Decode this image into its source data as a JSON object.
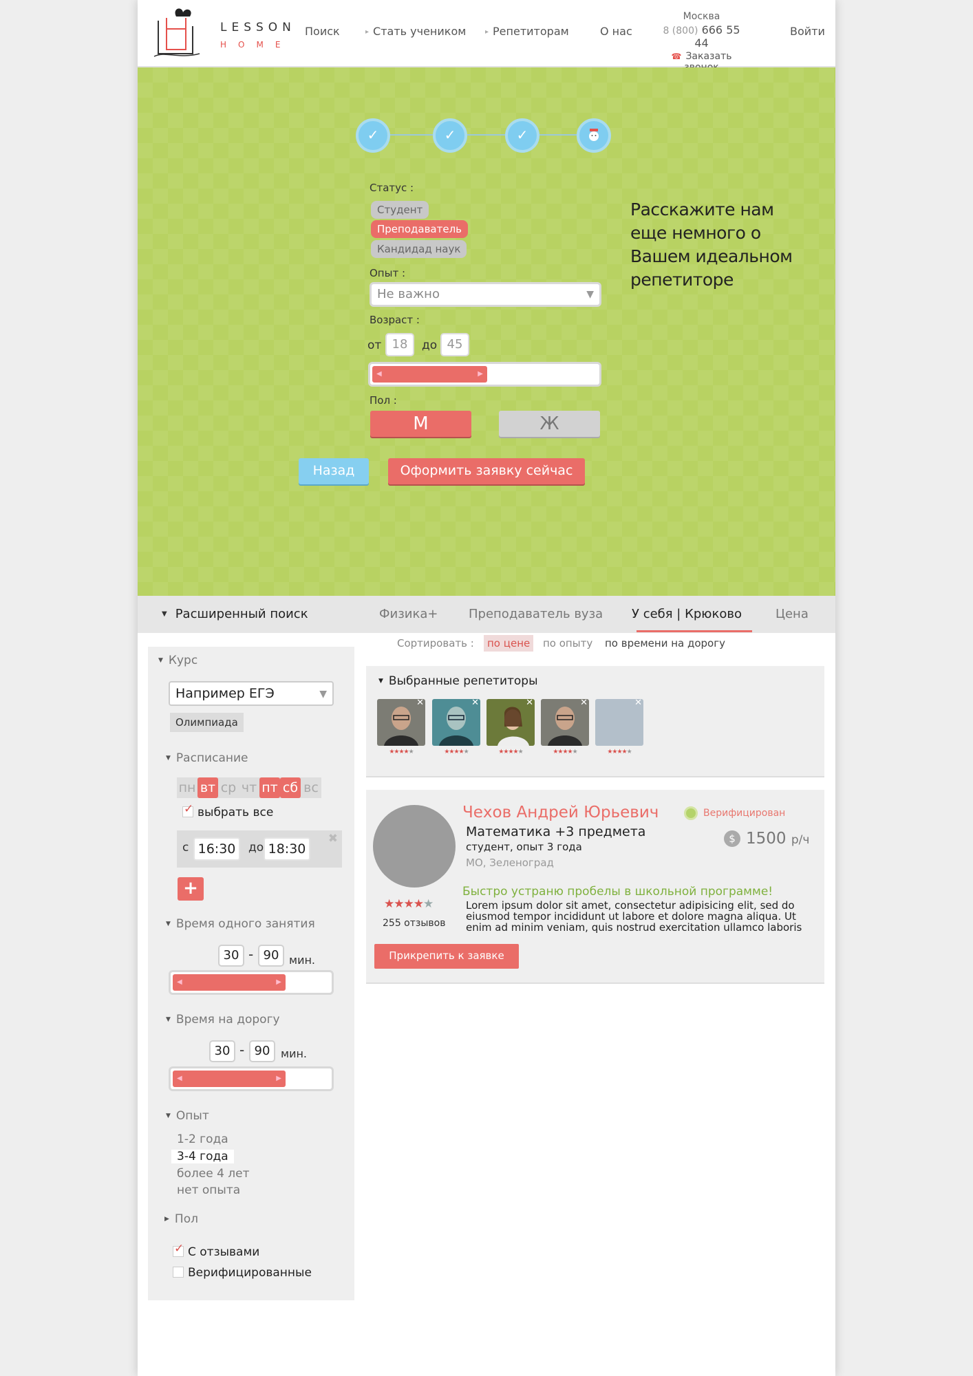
{
  "header": {
    "logo": {
      "word1": "LESSON",
      "word2": "HOME"
    },
    "nav": [
      {
        "label": "Поиск",
        "arrow": false
      },
      {
        "label": "Стать учеником",
        "arrow": true
      },
      {
        "label": "Репетиторам",
        "arrow": true
      },
      {
        "label": "О нас",
        "arrow": false
      }
    ],
    "contact": {
      "city": "Москва",
      "phone_prefix": "8 (800)",
      "phone": "666 55 44",
      "call_label": "Заказать звонок"
    },
    "login": "Войти"
  },
  "hero": {
    "steps": [
      {
        "state": "done",
        "icon": "check-icon"
      },
      {
        "state": "done",
        "icon": "check-icon"
      },
      {
        "state": "done",
        "icon": "check-icon"
      },
      {
        "state": "current",
        "icon": "student-avatar-icon"
      }
    ],
    "status_label": "Статус :",
    "status_options": [
      {
        "label": "Студент",
        "active": false
      },
      {
        "label": "Преподаватель",
        "active": true
      },
      {
        "label": "Кандидад наук",
        "active": false
      }
    ],
    "experience_label": "Опыт :",
    "experience_value": "Не важно",
    "age_label": "Возраст :",
    "age_from_label": "от",
    "age_from": "18",
    "age_to_label": "до",
    "age_to": "45",
    "age_range_fill": 0.5,
    "gender_label": "Пол :",
    "gender_m": "М",
    "gender_f": "Ж",
    "gender_selected": "М",
    "back_button": "Назад",
    "submit_button": "Оформить заявку сейчас",
    "side_text": "Расскажите нам еще немного о Вашем идеальном репетиторе"
  },
  "searchbar": {
    "title": "Расширенный поиск",
    "items": [
      {
        "label": "Физика+"
      },
      {
        "label": "Преподаватель вуза"
      },
      {
        "label": "У себя | Крюково",
        "active": true
      },
      {
        "label": "Цена"
      }
    ]
  },
  "sidebar": {
    "course_title": "Курс",
    "course_placeholder": "Например ЕГЭ",
    "course_tag": "Олимпиада",
    "schedule_title": "Расписание",
    "days": [
      {
        "label": "пн",
        "on": false
      },
      {
        "label": "вт",
        "on": true
      },
      {
        "label": "ср",
        "on": false
      },
      {
        "label": "чт",
        "on": false
      },
      {
        "label": "пт",
        "on": true
      },
      {
        "label": "сб",
        "on": true
      },
      {
        "label": "вс",
        "on": false
      }
    ],
    "select_all": "выбрать все",
    "time_from_label": "с",
    "time_from": "16:30",
    "time_to_label": "до",
    "time_to": "18:30",
    "add_label": "+",
    "lesson_time_title": "Время одного занятия",
    "lesson_min": "30",
    "lesson_max": "90",
    "lesson_unit": "мин.",
    "lesson_fill": 0.7,
    "road_time_title": "Время на дорогу",
    "road_min": "30",
    "road_max": "90",
    "road_unit": "мин.",
    "road_fill": 0.7,
    "experience_title": "Опыт",
    "experience_options": [
      {
        "label": "1-2 года",
        "selected": false
      },
      {
        "label": "3-4 года",
        "selected": true
      },
      {
        "label": "более 4 лет",
        "selected": false
      },
      {
        "label": "нет опыта",
        "selected": false
      }
    ],
    "gender_title": "Пол",
    "checks": [
      {
        "label": "С отзывами",
        "checked": true
      },
      {
        "label": "Верифицированные",
        "checked": false
      }
    ]
  },
  "sort": {
    "label": "Сортировать :",
    "options": [
      {
        "label": "по цене",
        "active": true
      },
      {
        "label": "по опыту",
        "active": false
      },
      {
        "label": "по времени на дорогу",
        "active": false
      }
    ]
  },
  "chosen": {
    "title": "Выбранные репетиторы",
    "tutors": [
      {
        "rating": 4,
        "photo": "man-glasses"
      },
      {
        "rating": 4,
        "photo": "man-glasses-teal"
      },
      {
        "rating": 4,
        "photo": "woman"
      },
      {
        "rating": 4,
        "photo": "man-glasses"
      },
      {
        "rating": 4,
        "photo": "empty"
      }
    ]
  },
  "card": {
    "name": "Чехов Андрей Юрьевич",
    "verified": "Верифицирован",
    "subjects": "Математика +3 предмета",
    "info": "студент, опыт 3 года",
    "location": "МО, Зеленоград",
    "price_value": "1500",
    "price_unit": "р/ч",
    "rating": 4,
    "reviews": "255 отзывов",
    "tagline": "Быстро устраню пробелы в школьной программе!",
    "description": "Lorem ipsum dolor sit amet, consectetur adipisicing elit, sed do eiusmod tempor incididunt ut labore et dolore magna aliqua. Ut enim ad minim veniam, quis nostrud exercitation ullamco laboris",
    "attach_button": "Прикрепить к заявке"
  },
  "colors": {
    "accent": "#ea6d68",
    "hero_green": "#b8d262",
    "step_blue": "#7fcdf0",
    "tagline_green": "#7fb13e"
  }
}
